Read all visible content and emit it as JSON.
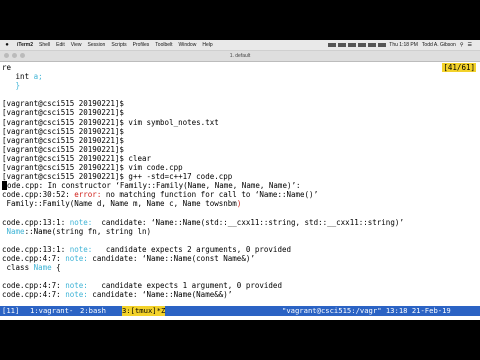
{
  "menubar": {
    "app": "iTerm2",
    "items": [
      "Shell",
      "Edit",
      "View",
      "Session",
      "Scripts",
      "Profiles",
      "Toolbelt",
      "Window",
      "Help"
    ],
    "clock": "Thu 1:18 PM",
    "user": "Todd A. Gibson"
  },
  "window": {
    "title": "1. default"
  },
  "vim": {
    "counter": "[41/61]"
  },
  "terminal": {
    "l1": "re",
    "l2a": "   int ",
    "l2b": "a",
    "l2c": ";",
    "l3": "   }",
    "l4": "",
    "p5": "[vagrant@csci515 20190221]$",
    "p6": "[vagrant@csci515 20190221]$",
    "p7": "[vagrant@csci515 20190221]$ vim symbol_notes.txt",
    "p8": "[vagrant@csci515 20190221]$",
    "p9": "[vagrant@csci515 20190221]$",
    "p10": "[vagrant@csci515 20190221]$",
    "p11": "[vagrant@csci515 20190221]$ clear",
    "p12": "[vagrant@csci515 20190221]$ vim code.cpp",
    "p13": "[vagrant@csci515 20190221]$ g++ -std=c++17 code.cpp",
    "e14": "ode.cpp: In constructor ‘Family::Family(Name, Name, Name, Name)’:",
    "e15a": "code.cpp:30:52: ",
    "e15b": "error:",
    "e15c": " no matching function for call to ‘Name::Name()’",
    "e16a": " Family::Family(Name d, Name m, Name c, Name towsnbm",
    "e16b": ")",
    "e17": "",
    "e18a": "code.cpp:13:1: ",
    "e18b": "note:",
    "e18c": "  candidate: ‘Name::Name(std::__cxx11::string, std::__cxx11::string)’",
    "e19a": " ",
    "e19b": "Name",
    "e19c": "::Name(string fn, string ln)",
    "e20": "",
    "e21a": "code.cpp:13:1: ",
    "e21b": "note:",
    "e21c": "   candidate expects 2 arguments, 0 provided",
    "e22a": "code.cpp:4:7: ",
    "e22b": "note:",
    "e22c": " candidate: ‘Name::Name(const Name&)’",
    "e23a": " class ",
    "e23b": "Name",
    "e23c": " {",
    "e24": "",
    "e25a": "code.cpp:4:7: ",
    "e25b": "note:",
    "e25c": "   candidate expects 1 argument, 0 provided",
    "e26a": "code.cpp:4:7: ",
    "e26b": "note:",
    "e26c": " candidate: ‘Name::Name(Name&&)’"
  },
  "status": {
    "session": "[11]",
    "w1": "1:vagrant-",
    "w2": "2:bash",
    "w3": "3:[tmux]*Z",
    "right": "\"vagrant@csci515:/vagr\" 13:18 21-Feb-19"
  }
}
